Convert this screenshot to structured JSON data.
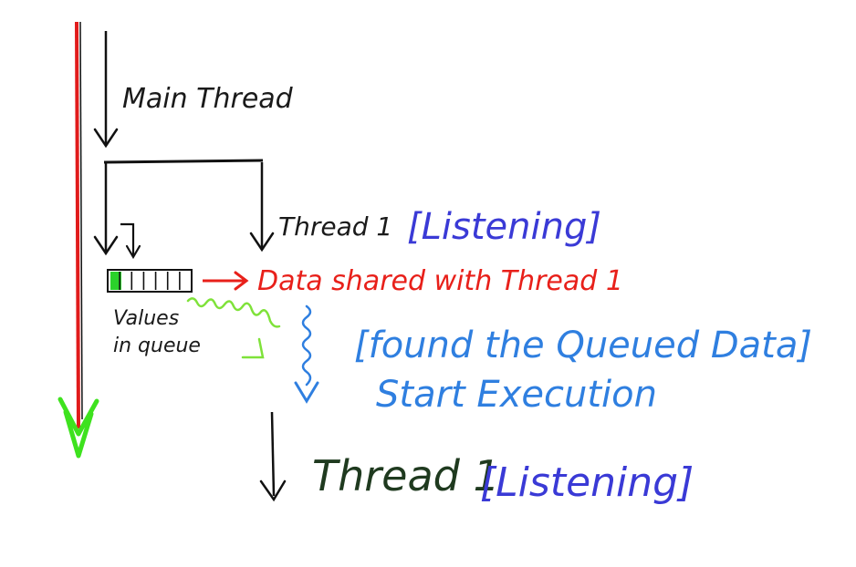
{
  "labels": {
    "main_thread": "Main Thread",
    "thread1": "Thread 1",
    "listening_top": "[Listening]",
    "data_shared": "Data shared with Thread 1",
    "values_line1": "Values",
    "values_line2": "in queue",
    "found_queued": "[found the Queued Data]",
    "start_execution": "Start Execution",
    "thread1_bottom": "Thread 1",
    "listening_bottom": "[Listening]"
  },
  "colors": {
    "main_line": "#e11b1b",
    "timeline_arrowhead": "#3ee21e",
    "ink": "#111111",
    "shared_arrow": "#e8201a",
    "queue_slot_filled": "#2bd12b",
    "queue_wave": "#7fe23a",
    "execution_wave": "#2f7fe0",
    "listening": "#3a3ad6"
  },
  "queue": {
    "slots": 7,
    "filled_slots": 1
  }
}
